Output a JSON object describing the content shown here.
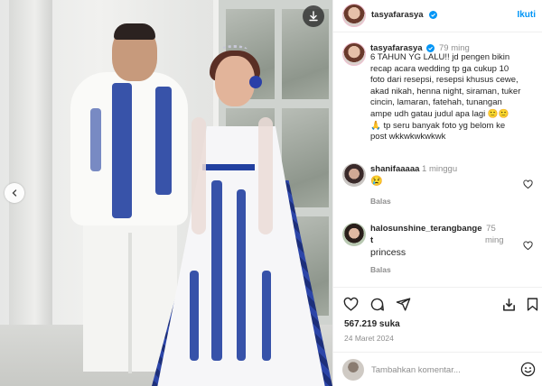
{
  "post": {
    "username": "tasyafarasya",
    "follow_label": "Ikuti",
    "more_icon": "more-dots-icon",
    "caption_time": "79 ming",
    "caption_lines": [
      "6 TAHUN YG LALU!! jd pengen bikin",
      "recap acara wedding tp ga cukup 10",
      "foto dari resepsi, resepsi khusus cewe,",
      "akad nikah, henna night, siraman, tuker",
      "cincin, lamaran, fatehah, tunangan",
      "ampe udh gatau judul apa lagi 🙂🙂",
      "🙏 tp seru banyak foto yg belom ke",
      "post wkkwkwkwkwk"
    ],
    "likes": "567.219 suka",
    "date": "24 Maret 2024"
  },
  "comments": [
    {
      "username": "shanifaaaaa",
      "time": "1 minggu",
      "text": "😢",
      "reply_label": "Balas"
    },
    {
      "username_line1": "halosunshine_terangbange",
      "username_line2": "t",
      "time_line1": "75",
      "time_line2": "ming",
      "text": "princess",
      "reply_label": "Balas"
    }
  ],
  "comment_box": {
    "placeholder": "Tambahkan komentar..."
  },
  "colors": {
    "accent": "#0095f6",
    "text": "#262626",
    "muted": "#8e8e8e",
    "border": "#efefef"
  },
  "icons": [
    "download-icon",
    "chevron-left-icon",
    "verified-icon",
    "heart-icon",
    "comment-icon",
    "share-icon",
    "save-icon",
    "emoji-icon"
  ]
}
